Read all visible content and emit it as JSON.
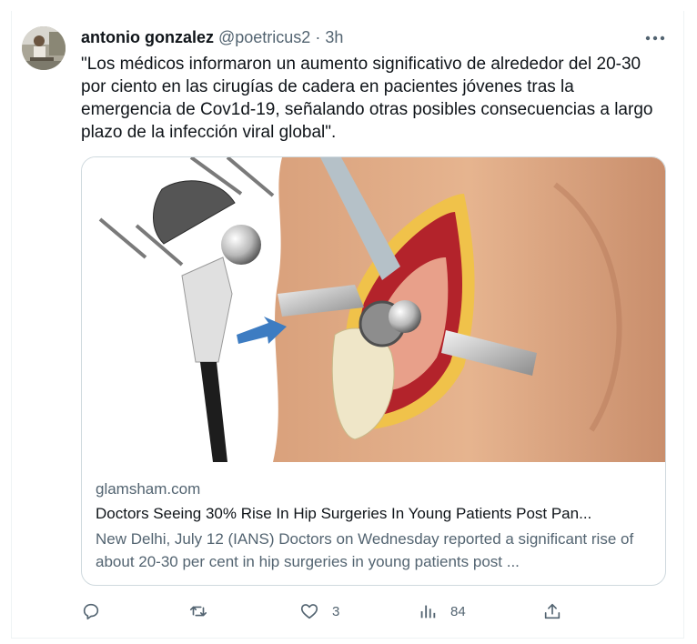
{
  "tweet": {
    "display_name": "antonio gonzalez",
    "handle": "@poetricus2",
    "separator": "·",
    "time": "3h",
    "text": "\"Los médicos informaron un aumento significativo de alrededor del 20-30 por ciento en las cirugías de cadera en pacientes jóvenes tras la emergencia de Cov1d-19, señalando otras posibles consecuencias a largo plazo de la infección viral global\"."
  },
  "card": {
    "domain": "glamsham.com",
    "title": "Doctors Seeing 30% Rise In Hip Surgeries In Young Patients Post Pan...",
    "description": "New Delhi, July 12 (IANS) Doctors on Wednesday reported a significant rise of about 20-30 per cent in hip surgeries in young patients post ..."
  },
  "actions": {
    "reply_count": "",
    "retweet_count": "",
    "like_count": "3",
    "views_count": "84"
  },
  "icons": [
    "avatar",
    "more-icon",
    "reply-icon",
    "retweet-icon",
    "like-icon",
    "views-icon",
    "share-icon"
  ],
  "colors": {
    "text_primary": "#0f1419",
    "text_secondary": "#536471",
    "border": "#cfd9de"
  }
}
